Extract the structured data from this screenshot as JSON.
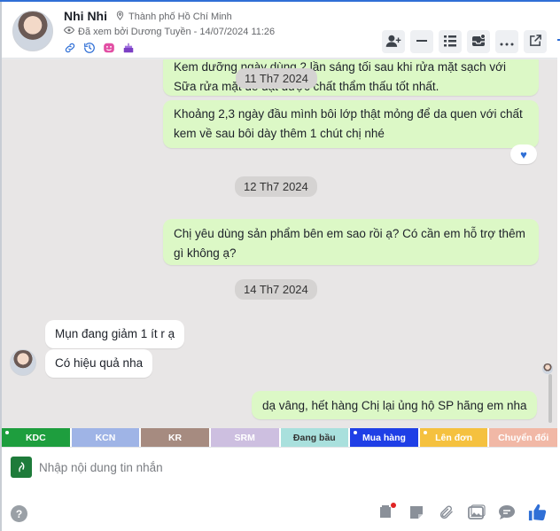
{
  "header": {
    "name": "Nhi Nhi",
    "location": "Thành phố Hồ Chí Minh",
    "seen_by": "Đã xem bởi Dương Tuyền - 14/07/2024 11:26",
    "tag_icons": [
      "link-icon",
      "history-icon",
      "emoji-icon",
      "birthday-cake-icon"
    ],
    "actions": [
      "add-member-icon",
      "minimize-icon",
      "list-icon",
      "inbox-icon",
      "more-icon",
      "open-external-icon"
    ]
  },
  "messages": {
    "m1": "Kem dưỡng ngày dùng 2 lần sáng tối sau khi rửa mặt sạch với Sữa rửa mặt để đạt được chất thẩm thấu tốt nhất.",
    "m2": "Khoảng 2,3 ngày đầu mình bôi lớp thật mỏng để da quen với chất kem về sau bôi dày thêm 1 chút chị nhé",
    "m3": "Chị yêu dùng sản phẩm bên em sao rồi ạ? Có cần em hỗ trợ thêm gì không ạ?",
    "m4": "Mụn đang giảm 1 ít r ạ",
    "m5": "Có hiệu quả nha",
    "m6": "dạ vâng, hết hàng Chị lại ủng hộ SP hãng em nha"
  },
  "dates": {
    "d1": "11 Th7 2024",
    "d2": "12 Th7 2024",
    "d3": "14 Th7 2024"
  },
  "labels": [
    {
      "text": "KDC",
      "bg": "#1e9e3e",
      "fg": "#ffffff",
      "dot": true
    },
    {
      "text": "KCN",
      "bg": "#9fb4e6",
      "fg": "#ffffff",
      "dot": false
    },
    {
      "text": "KR",
      "bg": "#a68b80",
      "fg": "#ffffff",
      "dot": false
    },
    {
      "text": "SRM",
      "bg": "#cdbfe0",
      "fg": "#ffffff",
      "dot": false
    },
    {
      "text": "Đang bầu",
      "bg": "#a9e0dd",
      "fg": "#333333",
      "dot": false
    },
    {
      "text": "Mua hàng",
      "bg": "#1f3fe6",
      "fg": "#ffffff",
      "dot": true
    },
    {
      "text": "Lên đơn",
      "bg": "#f5c13f",
      "fg": "#ffffff",
      "dot": true
    },
    {
      "text": "Chuyển đổi",
      "bg": "#f1b8a6",
      "fg": "#ffffff",
      "dot": false
    }
  ],
  "input": {
    "placeholder": "Nhập nội dung tin nhắn"
  },
  "toolbar": [
    "sticker-tag-icon",
    "note-icon",
    "attachment-icon",
    "image-icon",
    "chat-bubble-icon",
    "like-icon"
  ]
}
